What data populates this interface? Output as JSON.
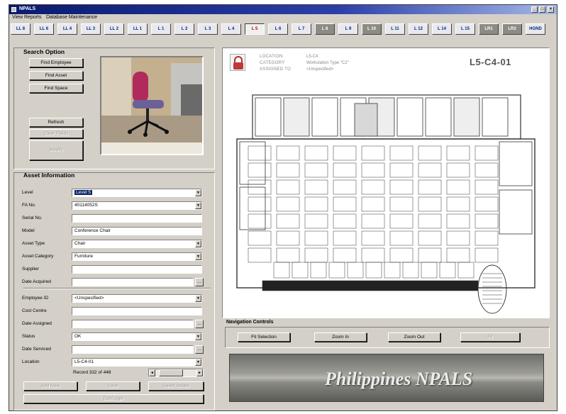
{
  "window": {
    "title": "NPALS"
  },
  "menu": [
    "View Reports",
    "Database Maintenance"
  ],
  "tabs": [
    {
      "label": "LL 8",
      "style": "normal"
    },
    {
      "label": "LL 6",
      "style": "normal"
    },
    {
      "label": "LL 4",
      "style": "normal"
    },
    {
      "label": "LL 3",
      "style": "normal"
    },
    {
      "label": "LL 2",
      "style": "normal"
    },
    {
      "label": "LL 1",
      "style": "normal"
    },
    {
      "label": "L 1",
      "style": "normal"
    },
    {
      "label": "L 2",
      "style": "normal"
    },
    {
      "label": "L 3",
      "style": "normal"
    },
    {
      "label": "L 4",
      "style": "normal"
    },
    {
      "label": "L 5",
      "style": "active"
    },
    {
      "label": "L 6",
      "style": "normal"
    },
    {
      "label": "L 7",
      "style": "normal"
    },
    {
      "label": "L 8",
      "style": "dark"
    },
    {
      "label": "L 9",
      "style": "normal"
    },
    {
      "label": "L 10",
      "style": "dark"
    },
    {
      "label": "L 11",
      "style": "normal"
    },
    {
      "label": "L 12",
      "style": "normal"
    },
    {
      "label": "L 14",
      "style": "normal"
    },
    {
      "label": "L 15",
      "style": "normal"
    },
    {
      "label": "LR1",
      "style": "dark"
    },
    {
      "label": "LR2",
      "style": "dark"
    },
    {
      "label": "HGND",
      "style": "normal"
    }
  ],
  "search": {
    "title": "Search Option",
    "find_employee": "Find Employee",
    "find_asset": "Find Asset",
    "find_space": "Find Space",
    "refresh": "Refresh",
    "clear_fields": "Clear Fields",
    "modify": "Modify"
  },
  "asset": {
    "title": "Asset Information",
    "fields": [
      {
        "label": "Level",
        "value": "Level 5",
        "control": "dropdown",
        "selected": true
      },
      {
        "label": "FA No.",
        "value": "40114052S",
        "control": "dropdown"
      },
      {
        "label": "Serial No.",
        "value": "",
        "control": "text"
      },
      {
        "label": "Model",
        "value": "Conference Chair",
        "control": "text"
      },
      {
        "label": "Asset Type",
        "value": "Chair",
        "control": "dropdown"
      },
      {
        "label": "Asset Category",
        "value": "Furniture",
        "control": "dropdown"
      },
      {
        "label": "Supplier",
        "value": "",
        "control": "text"
      },
      {
        "label": "Date Acquired",
        "value": "",
        "control": "date"
      },
      {
        "label": "Employee ID",
        "value": "<Unspecified>",
        "control": "dropdown"
      },
      {
        "label": "Cost Centre",
        "value": "",
        "control": "text"
      },
      {
        "label": "Date Assigned",
        "value": "",
        "control": "date"
      },
      {
        "label": "Status",
        "value": "OK",
        "control": "dropdown"
      },
      {
        "label": "Date Serviced",
        "value": "",
        "control": "date"
      },
      {
        "label": "Location",
        "value": "L5-C4-01",
        "control": "dropdown"
      }
    ],
    "record": "Record 332 of 448",
    "add_new": "Add New",
    "save": "Save",
    "save_update": "Save/Update",
    "exit": "Exit/Login"
  },
  "plan": {
    "location_label": "LOCATION",
    "location_value": "L5-C4",
    "category_label": "CATEGORY",
    "category_value": "Workstation Type \"C2\"",
    "assigned_label": "ASSIGNED TO",
    "assigned_value": "<Unspecified>",
    "room_code": "L5-C4-01"
  },
  "navigation": {
    "title": "Navigation Controls",
    "fit_selection": "Fit Selection",
    "zoom_in": "Zoom In",
    "zoom_out": "Zoom Out",
    "fit": "Fit"
  },
  "banner": {
    "text": "Philippines NPALS"
  },
  "colors": {
    "title_bar": "#0a1a6e",
    "active_tab": "#c00000",
    "tab_text": "#002a7a",
    "selection": "#0a246a"
  }
}
